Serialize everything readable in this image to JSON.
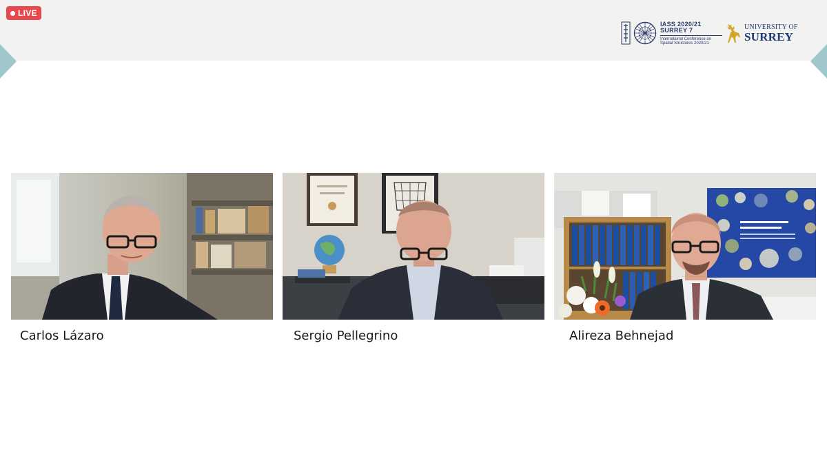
{
  "live_badge": {
    "label": "LIVE",
    "color": "#e5484d"
  },
  "conference_logo": {
    "mark": "IASS",
    "line1": "IASS 2020/21",
    "line2": "SURREY 7",
    "line3": "International Conference on",
    "line4": "Spatial Structures 2020/21",
    "icon": "geodesic-globe-icon"
  },
  "university_logo": {
    "line1": "UNIVERSITY OF",
    "line2": "SURREY",
    "icon": "stag-icon",
    "color": "#1d3b78"
  },
  "participants": [
    {
      "name": "Carlos Lázaro"
    },
    {
      "name": "Sergio Pellegrino"
    },
    {
      "name": "Alireza Behnejad"
    }
  ],
  "colors": {
    "topbar": "#f2f2f0",
    "accent_teal": "#9fc7cb"
  }
}
